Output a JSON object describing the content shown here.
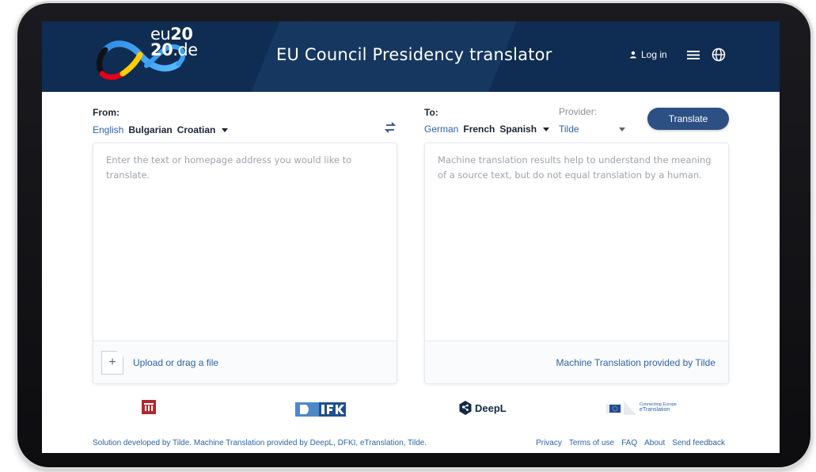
{
  "header": {
    "logo_line1_prefix": "eu",
    "logo_line1_bold": "20",
    "logo_line2_bold": "20",
    "logo_line2_suffix": ".de",
    "title": "EU Council Presidency translator",
    "login_label": "Log in",
    "icons": [
      "user-icon",
      "hamburger-menu-icon",
      "globe-icon"
    ]
  },
  "source": {
    "label": "From:",
    "languages": [
      "English",
      "Bulgarian",
      "Croatian"
    ],
    "active_language": "English",
    "placeholder": "Enter the text or homepage address you would like to translate.",
    "upload_label": "Upload or drag a file",
    "upload_icon": "+"
  },
  "target": {
    "label": "To:",
    "languages": [
      "German",
      "French",
      "Spanish"
    ],
    "active_language": "German",
    "placeholder": "Machine translation results help to understand the meaning of a source text, but do not equal translation by a human.",
    "credit": "Machine Translation provided by Tilde"
  },
  "provider": {
    "label": "Provider:",
    "selected": "Tilde"
  },
  "translate_button": "Translate",
  "partners": {
    "tilde": "TILDE",
    "deepl": "DeepL",
    "etranslation_line1": "Connecting Europe",
    "etranslation_line2": "eTranslation"
  },
  "footer": {
    "credit": "Solution developed by Tilde. Machine Translation provided by DeepL, DFKI, eTranslation, Tilde.",
    "links": [
      "Privacy",
      "Terms of use",
      "FAQ",
      "About",
      "Send feedback"
    ]
  },
  "colors": {
    "header_bg": "#0f2c52",
    "accent": "#2d63a8",
    "button": "#2c5083"
  }
}
